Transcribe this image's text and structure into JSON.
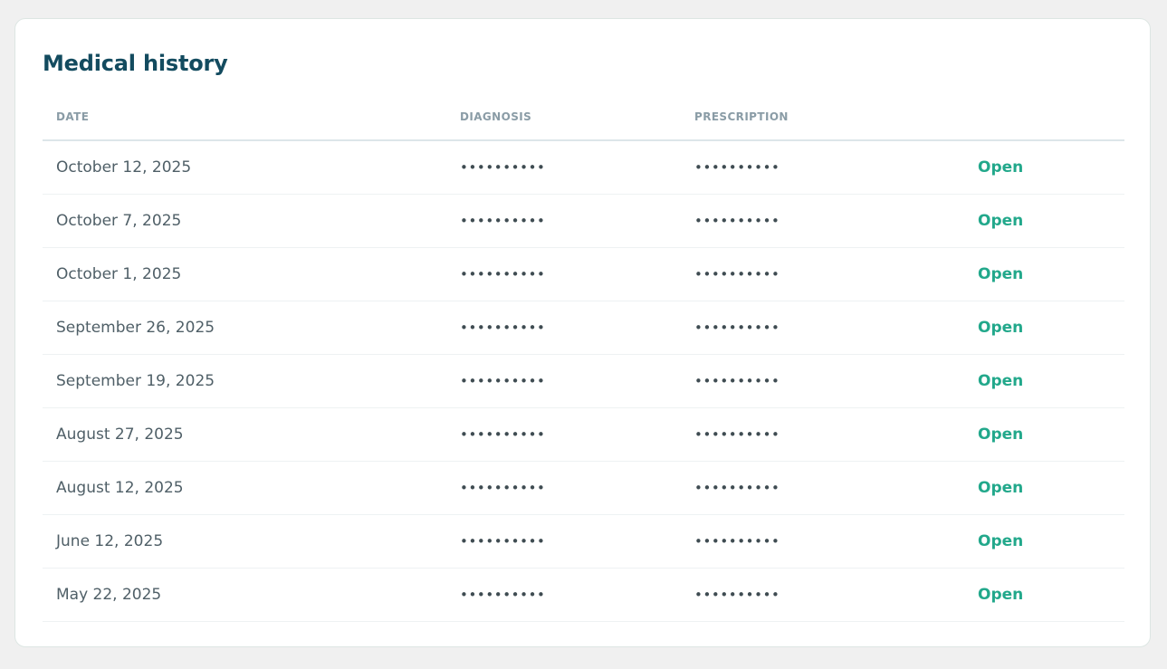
{
  "card": {
    "title": "Medical history"
  },
  "table": {
    "columns": [
      "DATE",
      "DIAGNOSIS",
      "PRESCRIPTION",
      ""
    ],
    "rows": [
      {
        "date": "October 12, 2025",
        "diagnosis": "••••••••••",
        "prescription": "••••••••••",
        "action": "Open"
      },
      {
        "date": "October 7, 2025",
        "diagnosis": "••••••••••",
        "prescription": "••••••••••",
        "action": "Open"
      },
      {
        "date": "October 1, 2025",
        "diagnosis": "••••••••••",
        "prescription": "••••••••••",
        "action": "Open"
      },
      {
        "date": "September 26, 2025",
        "diagnosis": "••••••••••",
        "prescription": "••••••••••",
        "action": "Open"
      },
      {
        "date": "September 19, 2025",
        "diagnosis": "••••••••••",
        "prescription": "••••••••••",
        "action": "Open"
      },
      {
        "date": "August 27, 2025",
        "diagnosis": "••••••••••",
        "prescription": "••••••••••",
        "action": "Open"
      },
      {
        "date": "August 12, 2025",
        "diagnosis": "••••••••••",
        "prescription": "••••••••••",
        "action": "Open"
      },
      {
        "date": "June 12, 2025",
        "diagnosis": "••••••••••",
        "prescription": "••••••••••",
        "action": "Open"
      },
      {
        "date": "May 22, 2025",
        "diagnosis": "••••••••••",
        "prescription": "••••••••••",
        "action": "Open"
      }
    ]
  },
  "colors": {
    "title": "#134b5f",
    "header_text": "#8a9ca6",
    "body_text": "#4f5f67",
    "link": "#22a88b",
    "page_background": "#f0f0f0"
  }
}
